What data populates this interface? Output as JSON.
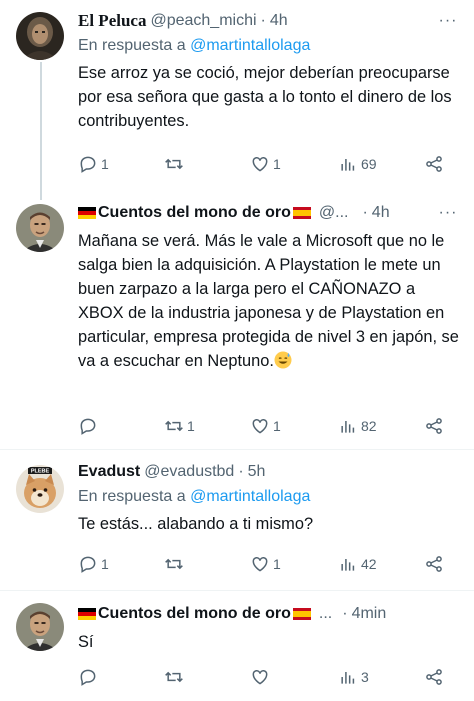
{
  "tweets": [
    {
      "name": "El Peluca",
      "handle": "@peach_michi",
      "dot": "·",
      "time": "4h",
      "reply_prefix": "En respuesta a",
      "reply_mention": "@martintallolaga",
      "text": "Ese arroz ya se coció, mejor deberían preocuparse por esa señora que gasta a lo tonto el dinero de los contribuyentes.",
      "replies": "1",
      "retweets": "",
      "likes": "1",
      "views": "69"
    },
    {
      "name": "Cuentos del mono de oro",
      "handle": "@...",
      "dot": "·",
      "time": "4h",
      "text": "Mañana se verá. Más le vale a Microsoft que no le salga bien la adquisición. A Playstation le mete un buen zarpazo a la larga pero el CAÑONAZO a XBOX de la industria japonesa y de Playstation en particular, empresa protegida de nivel 3 en japón, se va a escuchar en Neptuno.",
      "replies": "",
      "retweets": "1",
      "likes": "1",
      "views": "82"
    },
    {
      "name": "Evadust",
      "handle": "@evadustbd",
      "dot": "·",
      "time": "5h",
      "reply_prefix": "En respuesta a",
      "reply_mention": "@martintallolaga",
      "text": "Te estás... alabando a ti mismo?",
      "replies": "1",
      "retweets": "",
      "likes": "1",
      "views": "42",
      "avatar_label": "PLEBE"
    },
    {
      "name": "Cuentos del mono de oro",
      "handle": "...",
      "dot": "·",
      "time": "4min",
      "text": "Sí",
      "replies": "",
      "retweets": "",
      "likes": "",
      "views": "3"
    }
  ],
  "icons": {
    "more": "more-options-icon",
    "reply": "reply-icon",
    "retweet": "retweet-icon",
    "like": "heart-icon",
    "views": "views-chart-icon",
    "share": "share-icon",
    "flag": "spain-flag-icon",
    "emoji": "sweat-smile-emoji"
  },
  "colors": {
    "link": "#1d9bf0",
    "secondary": "#536471",
    "primary": "#0f1419",
    "divider": "#eff3f4",
    "thread_line": "#cfd9de"
  }
}
